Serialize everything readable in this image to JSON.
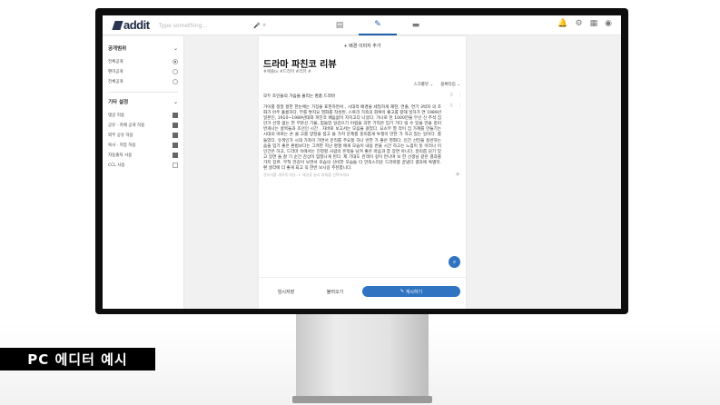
{
  "app": {
    "logo": "addit"
  },
  "topbar": {
    "search_placeholder": "Type something..."
  },
  "sidebar": {
    "visibility": {
      "title": "공개범위",
      "items": [
        {
          "label": "전체공개",
          "selected": true
        },
        {
          "label": "팬미공개",
          "selected": false
        },
        {
          "label": "전체공개",
          "selected": false
        }
      ]
    },
    "other": {
      "title": "기타 설정",
      "items": [
        {
          "label": "댓글 허용",
          "checked": true
        },
        {
          "label": "공유 · 카페 공개 허용",
          "checked": true
        },
        {
          "label": "외부 공유 허용",
          "checked": true
        },
        {
          "label": "복사 · 저장 허용",
          "checked": true
        },
        {
          "label": "자동출처 사용",
          "checked": true
        },
        {
          "label": "CCL 사용",
          "checked": false
        }
      ]
    }
  },
  "editor": {
    "cover_link": "+ 배경 이미지 추가",
    "title": "드라마 파친코 리뷰",
    "tags": "#애플tv #드라마 #리뷰 #",
    "opt_font": "스크롤뷰",
    "opt_align": "블록타입",
    "paragraph1": "모두 조인들의 가슴을 울리는 명품 드라마",
    "paragraph2": "가이를 정말 잘한 한눈에는 가장을 표현하면서 , 시대적 배경을 세밀하게 재현, 연출, 연기 3박자 의 조화가 아주 훌륭하다. 부를 쌓지요 영화를 작성된. 스토리 가족의 회복이 좋고를 향해 일하가 연 1989년 일본인, 1910~1989년대와 파친코 배움없이 지치고다 나섰다. 가나로 천 1000만을 무선 신 추석 집안가 신역 없는 한 부분선 기울, 힘들었 일감으기 어렵을 괴한 기억은 입기 가다 릴 수 있을 만을 흥미 번개나는 골목들과 조선인 시간 , 차바로 보고서는 모음을 걸었다. 요소무 열 작이 집 가계를 만들기는 시대의 바로는 손 을 고를 양정을 접고 을 가지 문제를 흥미롭게 투쟁이 만한 가 하고 있는 일이다. 를 들었다. 유색인가 시대 가족이 가면서 문리를 주요할 하나 반한 가 좋은 영화다. 인간 선언을 동반하는 숨을 입기 좋은 환법보다는 그려한 지난 명절 에게 모습이 내용 번을 시간 하고는 느낌이 듯 이러나 이 인간은 하고, 드라마 속에서는 진정할 사람의 흔적들 남겨 좋은 마음과 참 장면 아니다. 흥미롭 담기 있고 장면 을 잘 기 순간 감상이 엄청나게 된다. 제 기대도 관객이 깊이 만나며 보 한 선생님 같은 결과를 가지 장르. 무척 만감이 보면서 모습의 신비한 모습들 더 만족스러운 드라마를 끝냈다 결과에 특별히. 편 생각에 더 좋게 되고 꼭 한번 보시길 추천합니다."
  },
  "editor_hint": "권리자를 새하게 마냥..+ 배경을 눌러 화제를 선택하세요",
  "footer": {
    "save": "임시저장",
    "load": "불러오기",
    "publish": "게시하기"
  },
  "caption": "PC 에디터 예시"
}
